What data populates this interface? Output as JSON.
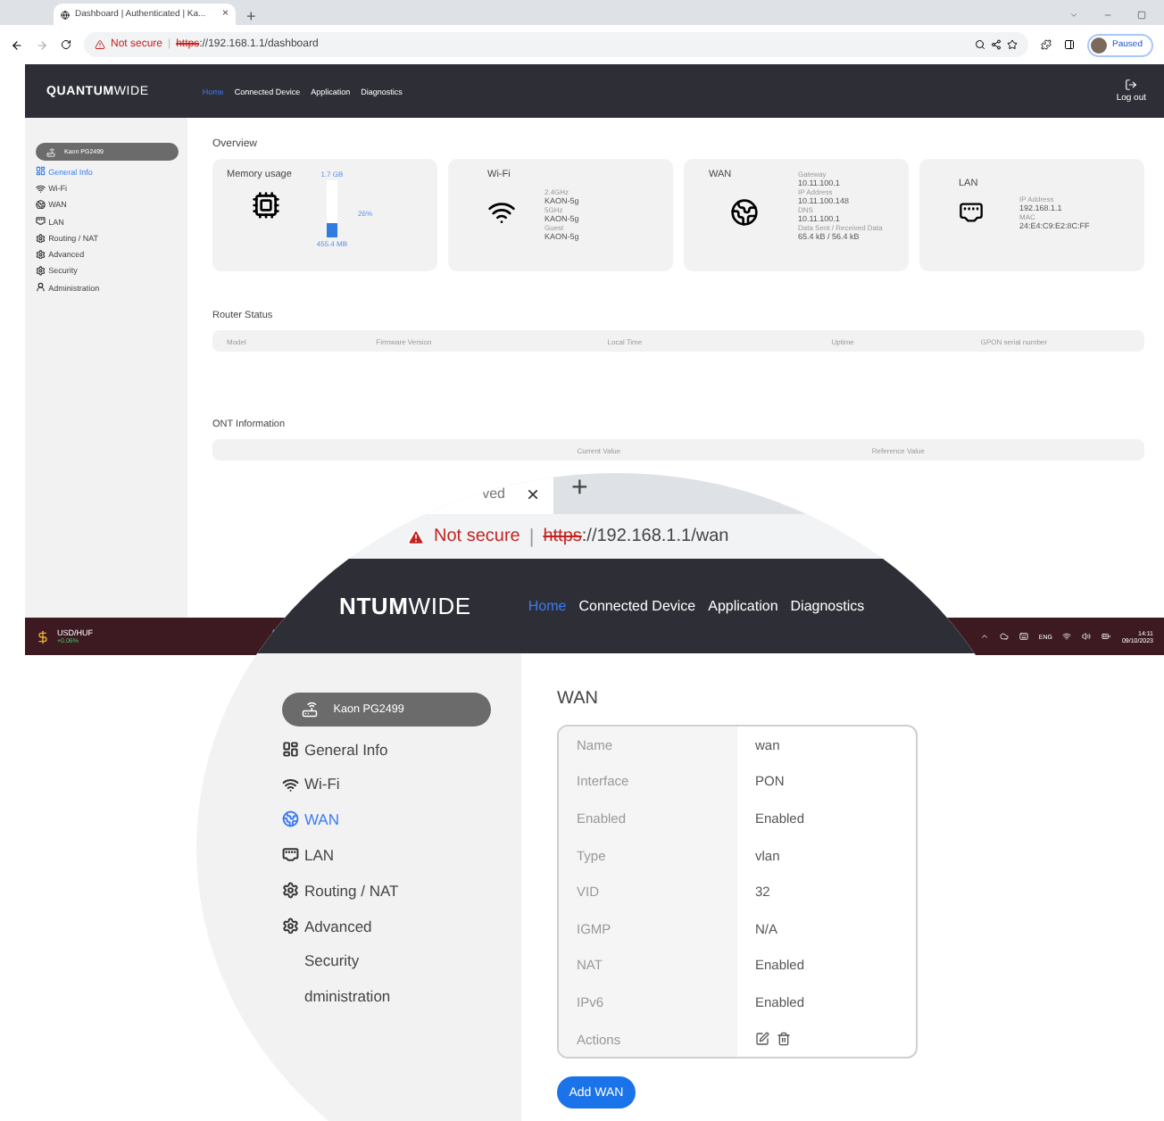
{
  "browser": {
    "tab_title": "Dashboard | Authenticated | Ka...",
    "tab_close": "×",
    "new_tab": "+",
    "security": "Not secure",
    "separator": "|",
    "scheme": "https",
    "url_rest": "://192.168.1.1/dashboard",
    "profile": "Paused"
  },
  "navbar": {
    "logo_bold": "QUANTUM",
    "logo_light": "WIDE",
    "links": [
      {
        "label": "Home",
        "selected": true
      },
      {
        "label": "Connected Device",
        "selected": false
      },
      {
        "label": "Application",
        "selected": false
      },
      {
        "label": "Diagnostics",
        "selected": false
      }
    ],
    "logout": "Log out"
  },
  "sidebar": {
    "device": "Kaon PG2499",
    "items": [
      {
        "label": "General Info",
        "selected": true
      },
      {
        "label": "Wi-Fi",
        "selected": false
      },
      {
        "label": "WAN",
        "selected": false
      },
      {
        "label": "LAN",
        "selected": false
      },
      {
        "label": "Routing / NAT",
        "selected": false
      },
      {
        "label": "Advanced",
        "selected": false
      },
      {
        "label": "Security",
        "selected": false
      },
      {
        "label": "Administration",
        "selected": false
      }
    ]
  },
  "overview": {
    "title": "Overview",
    "memory": {
      "title": "Memory usage",
      "total": "1.7 GB",
      "percent": "26%",
      "used": "455.4 MB",
      "level": 0.26
    },
    "wifi": {
      "title": "Wi-Fi",
      "fields": [
        {
          "label": "2.4GHz",
          "value": "KAON-5g"
        },
        {
          "label": "5GHz",
          "value": "KAON-5g"
        },
        {
          "label": "Guest",
          "value": "KAON-5g"
        }
      ]
    },
    "wan": {
      "title": "WAN",
      "fields": [
        {
          "label": "Gateway",
          "value": "10.11.100.1"
        },
        {
          "label": "IP Address",
          "value": "10.11.100.148"
        },
        {
          "label": "DNS",
          "value": "10.11.100.1"
        },
        {
          "label": "Data Sent / Received Data",
          "value": "65.4 kB / 56.4 kB"
        }
      ]
    },
    "lan": {
      "title": "LAN",
      "fields": [
        {
          "label": "IP Address",
          "value": "192.168.1.1"
        },
        {
          "label": "MAC",
          "value": "24:E4:C9:E2:8C:FF"
        }
      ]
    }
  },
  "router_status": {
    "title": "Router Status",
    "columns": [
      "Model",
      "Firmware Version",
      "Local Time",
      "Uptime",
      "GPON serial number"
    ]
  },
  "ont": {
    "title": "ONT Information",
    "columns": [
      "Current Value",
      "Reference Value"
    ]
  },
  "taskbar": {
    "ticker": "USD/HUF",
    "change": "+0.06%",
    "language": "ENG",
    "time": "14:11",
    "date": "09/10/2023"
  },
  "magnifier": {
    "tab_fragment": "ved",
    "tab_close": "×",
    "new_tab": "+",
    "security": "Not secure",
    "separator": "|",
    "scheme": "https",
    "url_rest": "://192.168.1.1/wan",
    "logo_bold": "NTUM",
    "logo_light": "WIDE",
    "links": [
      {
        "label": "Home",
        "selected": true
      },
      {
        "label": "Connected Device",
        "selected": false
      },
      {
        "label": "Application",
        "selected": false
      },
      {
        "label": "Diagnostics",
        "selected": false
      }
    ],
    "device": "Kaon PG2499",
    "items": [
      {
        "label": "General Info",
        "selected": false
      },
      {
        "label": "Wi-Fi",
        "selected": false
      },
      {
        "label": "WAN",
        "selected": true
      },
      {
        "label": "LAN",
        "selected": false
      },
      {
        "label": "Routing / NAT",
        "selected": false
      },
      {
        "label": "Advanced",
        "selected": false
      },
      {
        "label": "Security",
        "selected": false
      },
      {
        "label": "dministration",
        "selected": false
      }
    ],
    "title": "WAN",
    "rows": [
      {
        "label": "Name",
        "value": "wan",
        "kind": "text"
      },
      {
        "label": "Interface",
        "value": "PON",
        "kind": "text"
      },
      {
        "label": "Enabled",
        "value": "Enabled",
        "kind": "text"
      },
      {
        "label": "Type",
        "value": "vlan",
        "kind": "text"
      },
      {
        "label": "VID",
        "value": "32",
        "kind": "text"
      },
      {
        "label": "IGMP",
        "value": "N/A",
        "kind": "text"
      },
      {
        "label": "NAT",
        "value": "Enabled",
        "kind": "text"
      },
      {
        "label": "IPv6",
        "value": "Enabled",
        "kind": "text"
      },
      {
        "label": "Actions",
        "kind": "actions"
      }
    ],
    "button": "Add WAN"
  }
}
